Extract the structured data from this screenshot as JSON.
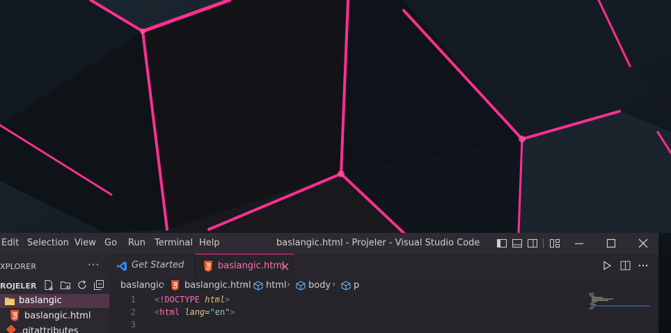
{
  "colors": {
    "accent": "#ff2f92",
    "background": "#101418",
    "titlebar": "#2f2b33",
    "editor": "#25252b",
    "active_folder": "#51364a"
  },
  "menu": [
    "Edit",
    "Selection",
    "View",
    "Go",
    "Run",
    "Terminal",
    "Help"
  ],
  "window_title": "baslangic.html - Projeler - Visual Studio Code",
  "explorer": {
    "title": "XPLORER",
    "more": "···",
    "project": "ROJELER",
    "items": [
      {
        "label": "baslangic",
        "type": "folder",
        "active": true
      },
      {
        "label": "baslangic.html",
        "type": "html"
      },
      {
        "label": ".gitattributes",
        "type": "git"
      }
    ]
  },
  "tabs": [
    {
      "label": "Get Started",
      "icon": "vscode-icon",
      "active": false
    },
    {
      "label": "baslangic.html",
      "icon": "html5-icon",
      "active": true
    }
  ],
  "breadcrumb": [
    "baslangic",
    "baslangic.html",
    "html",
    "body",
    "p"
  ],
  "editor_lines": [
    {
      "number": "1",
      "text": "<!DOCTYPE html>"
    },
    {
      "number": "2",
      "text": "<html lang=\"en\">"
    },
    {
      "number": "3",
      "text": ""
    }
  ]
}
